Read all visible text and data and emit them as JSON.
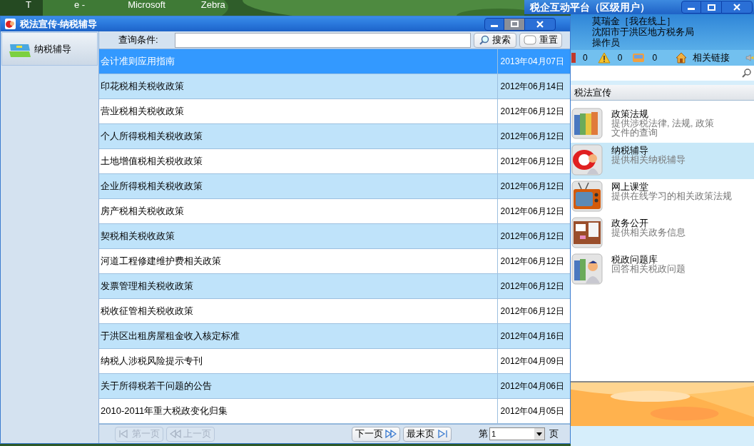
{
  "desktop_icons": [
    {
      "label": "T"
    },
    {
      "label": "e -"
    },
    {
      "label": "Microsoft"
    },
    {
      "label": "Zebra"
    }
  ],
  "main_window": {
    "title": "税法宣传-纳税辅导",
    "nav": [
      {
        "label": "纳税辅导",
        "selected": true
      }
    ],
    "search": {
      "label": "查询条件:",
      "buttons": [
        {
          "label": "搜索",
          "kind": "search"
        },
        {
          "label": "重置",
          "kind": "reset"
        }
      ]
    },
    "rows": [
      {
        "title": "会计准则应用指南",
        "date": "2013年04月07日",
        "selected": true
      },
      {
        "title": "印花税相关税收政策",
        "date": "2012年06月14日",
        "selected": false
      },
      {
        "title": "营业税相关税收政策",
        "date": "2012年06月12日",
        "selected": false
      },
      {
        "title": "个人所得税相关税收政策",
        "date": "2012年06月12日",
        "selected": false
      },
      {
        "title": "土地增值税相关税收政策",
        "date": "2012年06月12日",
        "selected": false
      },
      {
        "title": "企业所得税相关税收政策",
        "date": "2012年06月12日",
        "selected": false
      },
      {
        "title": "房产税相关税收政策",
        "date": "2012年06月12日",
        "selected": false
      },
      {
        "title": "契税相关税收政策",
        "date": "2012年06月12日",
        "selected": false
      },
      {
        "title": "河道工程修建维护费相关政策",
        "date": "2012年06月12日",
        "selected": false
      },
      {
        "title": "发票管理相关税收政策",
        "date": "2012年06月12日",
        "selected": false
      },
      {
        "title": "税收征管相关税收政策",
        "date": "2012年06月12日",
        "selected": false
      },
      {
        "title": "于洪区出租房屋租金收入核定标准",
        "date": "2012年04月16日",
        "selected": false
      },
      {
        "title": "纳税人涉税风险提示专刊",
        "date": "2012年04月09日",
        "selected": false
      },
      {
        "title": "关于所得税若干问题的公告",
        "date": "2012年04月06日",
        "selected": false
      },
      {
        "title": "2010-2011年重大税政变化归集",
        "date": "2012年04月05日",
        "selected": false
      }
    ],
    "pager": {
      "buttons": [
        {
          "label": "第一页",
          "kind": "first",
          "disabled": true
        },
        {
          "label": "上一页",
          "kind": "prev",
          "disabled": true
        },
        {
          "label": "下一页",
          "kind": "next",
          "disabled": false
        },
        {
          "label": "最末页",
          "kind": "last",
          "disabled": false
        }
      ],
      "page_prefix": "第",
      "page_value": "1",
      "page_suffix": "页"
    }
  },
  "side_window": {
    "title": "税企互动平台（区级用户）",
    "user": {
      "name": "莫瑞金［我在线上］",
      "org": "沈阳市于洪区地方税务局",
      "role": "操作员"
    },
    "counters": [
      {
        "value": "0",
        "kind": "calendar"
      },
      {
        "value": "0",
        "kind": "warning"
      },
      {
        "value": "0",
        "kind": "inbox"
      }
    ],
    "links_label": "相关链接",
    "section": "税法宣传",
    "items": [
      {
        "title": "政策法规",
        "desc": "提供涉税法律, 法规, 政策文件的查询",
        "kind": "binders",
        "selected": false
      },
      {
        "title": "纳税辅导",
        "desc": "提供相关纳税辅导",
        "kind": "phone",
        "selected": true
      },
      {
        "title": "网上课堂",
        "desc": "提供在线学习的相关政策法规",
        "kind": "tv",
        "selected": false
      },
      {
        "title": "政务公开",
        "desc": "提供相关政务信息",
        "kind": "board",
        "selected": false
      },
      {
        "title": "税政问题库",
        "desc": "回答相关税政问题",
        "kind": "person",
        "selected": false
      }
    ]
  }
}
